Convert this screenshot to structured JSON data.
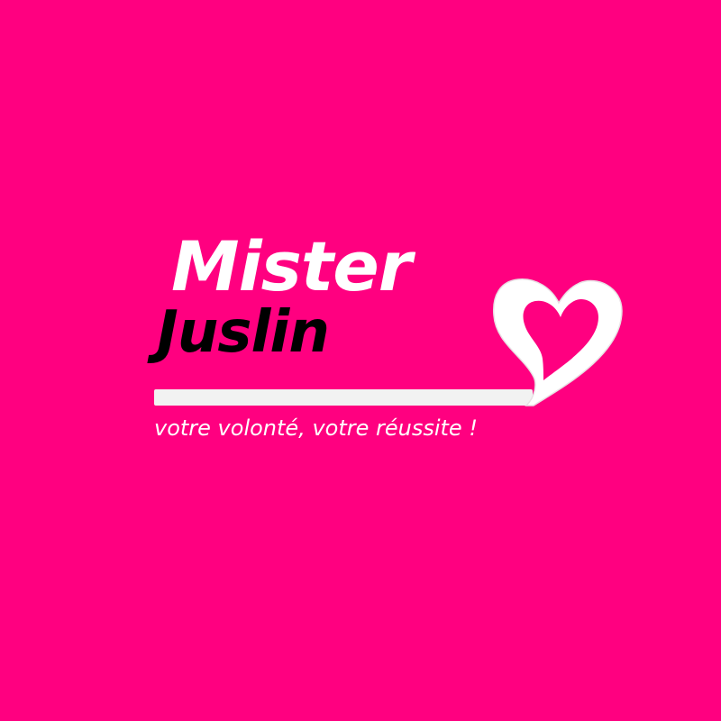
{
  "logo": {
    "line1": "Mister",
    "line2": "Juslin",
    "tagline": "votre volonté, votre réussite !"
  },
  "colors": {
    "background": "#ff0080",
    "line1": "#ffffff",
    "line2": "#000000",
    "bar": "#f2f2f2",
    "tagline": "#ffffff",
    "heart": "#ffffff"
  },
  "icons": {
    "heart": "heart-icon"
  }
}
